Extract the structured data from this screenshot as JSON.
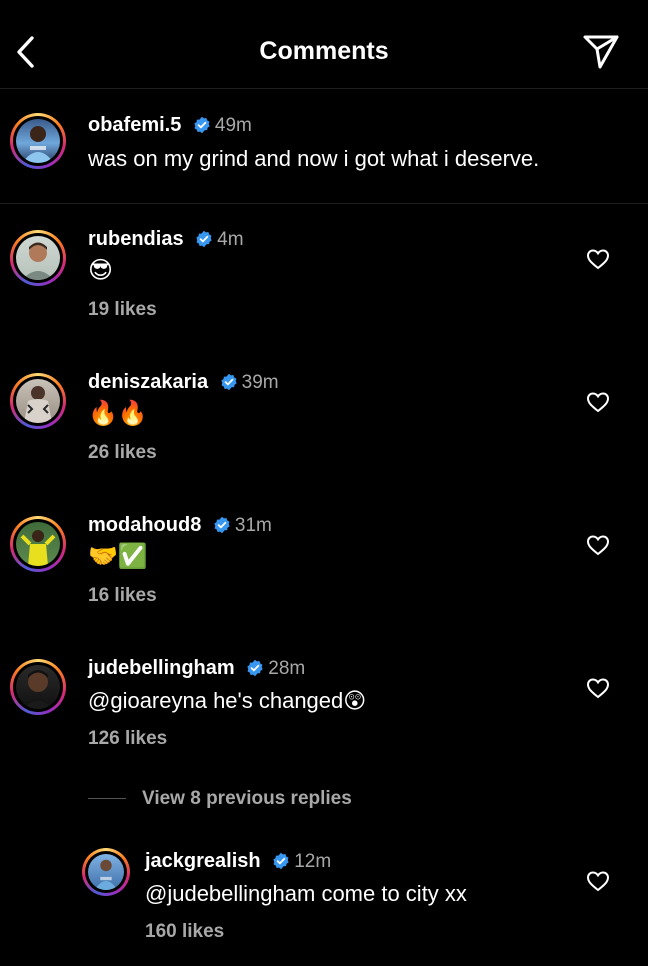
{
  "header": {
    "title": "Comments"
  },
  "caption": {
    "username": "obafemi.5",
    "time": "49m",
    "text": "was on my grind and now i got what i deserve."
  },
  "comments": [
    {
      "username": "rubendias",
      "time": "4m",
      "text": "😎",
      "likes": "19 likes"
    },
    {
      "username": "deniszakaria",
      "time": "39m",
      "text": "🔥🔥",
      "likes": "26 likes"
    },
    {
      "username": "modahoud8",
      "time": "31m",
      "text": "🤝✅",
      "likes": "16 likes"
    },
    {
      "username": "judebellingham",
      "time": "28m",
      "text": "@gioareyna he's changed😲",
      "likes": "126 likes"
    }
  ],
  "view_replies": "View 8 previous replies",
  "reply": {
    "username": "jackgrealish",
    "time": "12m",
    "text": "@judebellingham come to city xx",
    "likes": "160 likes"
  },
  "colors": {
    "background": "#000000",
    "verified": "#3897f0",
    "muted": "#a8a8a8"
  }
}
